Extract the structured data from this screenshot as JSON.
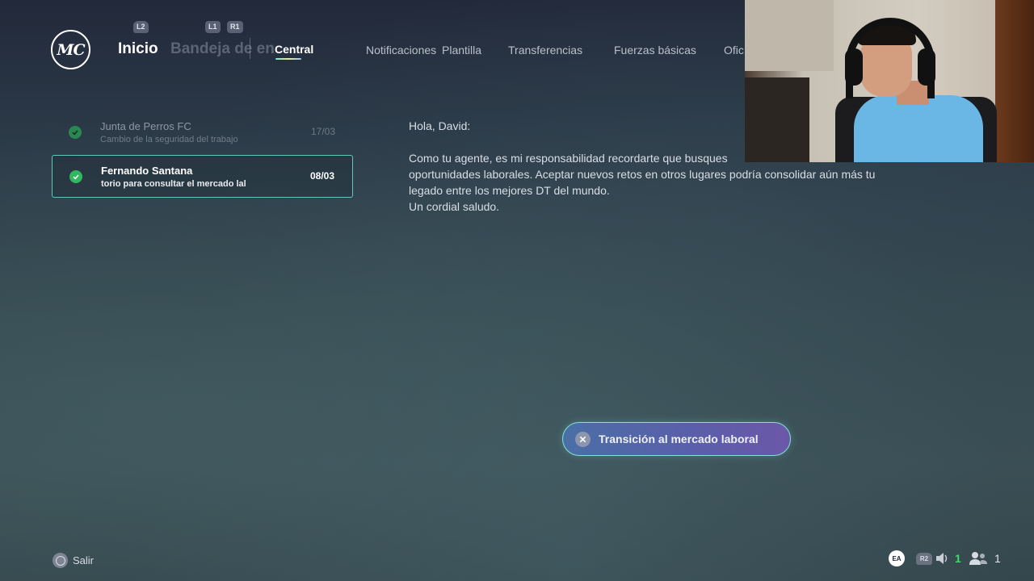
{
  "header": {
    "logo_text": "MC",
    "hints": {
      "l2": "L2",
      "l1": "L1",
      "r1": "R1"
    },
    "tabs": {
      "inicio": "Inicio",
      "bandeja": "Bandeja de en",
      "central": "Central"
    },
    "nav": [
      "Notificaciones",
      "Plantilla",
      "Transferencias",
      "Fuerzas básicas",
      "Ofic"
    ]
  },
  "inbox": [
    {
      "sender": "Junta de Perros FC",
      "subject": "Cambio de la seguridad del trabajo",
      "date": "17/03",
      "selected": false
    },
    {
      "sender": "Fernando Santana",
      "subject": "torio para consultar el mercado lal",
      "date": "08/03",
      "selected": true
    }
  ],
  "message": {
    "greeting": "Hola, David:",
    "lines": [
      "Como tu agente, es mi responsabilidad recordarte que busques",
      "oportunidades laborales. Aceptar nuevos retos en otros lugares podría consolidar aún más tu",
      "legado entre los mejores DT del mundo.",
      "Un cordial saludo."
    ]
  },
  "action": {
    "label": "Transición al mercado laboral",
    "icon": "cross-button-icon"
  },
  "footer": {
    "back_label": "Salir",
    "ea_label": "EA",
    "r2_label": "R2",
    "speaker_count": "1",
    "people_count": "1"
  },
  "colors": {
    "accent_teal": "#5fc8b8",
    "check_green": "#31b75f",
    "speaker_green": "#3ddc6b"
  }
}
